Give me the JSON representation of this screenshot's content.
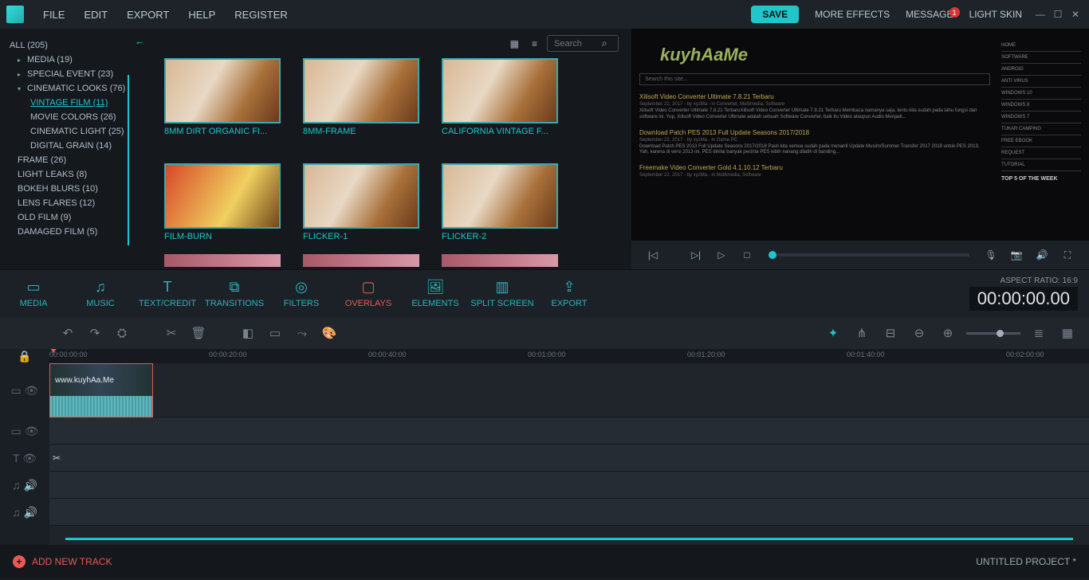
{
  "menu": {
    "file": "FILE",
    "edit": "EDIT",
    "export": "EXPORT",
    "help": "HELP",
    "register": "REGISTER"
  },
  "topbar": {
    "save": "SAVE",
    "more_effects": "MORE EFFECTS",
    "message": "MESSAGE",
    "badge": "1",
    "light_skin": "LIGHT SKIN"
  },
  "sidebar": {
    "items": [
      {
        "label": "ALL (205)",
        "level": 1
      },
      {
        "label": "MEDIA (19)",
        "level": 2,
        "chev": "▸"
      },
      {
        "label": "SPECIAL EVENT (23)",
        "level": 2,
        "chev": "▸"
      },
      {
        "label": "CINEMATIC LOOKS (76)",
        "level": 2,
        "chev": "▾"
      },
      {
        "label": "VINTAGE FILM (11)",
        "level": 3,
        "active": true
      },
      {
        "label": "MOVIE COLORS (26)",
        "level": 3
      },
      {
        "label": "CINEMATIC LIGHT (25)",
        "level": 3
      },
      {
        "label": "DIGITAL GRAIN (14)",
        "level": 3
      },
      {
        "label": "FRAME (26)",
        "level": 2
      },
      {
        "label": "LIGHT LEAKS (8)",
        "level": 2
      },
      {
        "label": "BOKEH BLURS (10)",
        "level": 2
      },
      {
        "label": "LENS FLARES (12)",
        "level": 2
      },
      {
        "label": "OLD FILM (9)",
        "level": 2
      },
      {
        "label": "DAMAGED FILM (5)",
        "level": 2
      }
    ]
  },
  "search": {
    "placeholder": "Search"
  },
  "thumbs": [
    {
      "label": "8MM DIRT ORGANIC FI..."
    },
    {
      "label": "8MM-FRAME"
    },
    {
      "label": "CALIFORNIA VINTAGE F..."
    },
    {
      "label": "FILM-BURN"
    },
    {
      "label": "FLICKER-1"
    },
    {
      "label": "FLICKER-2"
    }
  ],
  "preview": {
    "logo": "kuyhAaMe",
    "search": "Search this site...",
    "entries": [
      {
        "t": "Xilisoft Video Converter Ultimate 7.8.21 Terbaru",
        "m": "September 22, 2017 - by xyzMa - in Converter, Multimedia, Software",
        "d": "Xilisoft Video Converter Ultimate 7.8.21 TerbaruXilisoft Video Converter Ultimate 7.8.21 Terbaru Membaca namanya saja, tentu kita sudah pada tahu fungsi dari software ini. Yup, Xilisoft Video Converter Ultimate adalah sebuah Software Converter, baik itu Video ataupun Audio Menjadi..."
      },
      {
        "t": "Download Patch PES 2013 Full Update Seasons 2017/2018",
        "m": "September 22, 2017 - by xyzMa - in Game PC",
        "d": "Download Patch PES 2013 Full Update Seasons 2017/2018 Pasti kita semua sudah pada menanti Update Musim/Summer Transfer 2017 2018 untuk PES 2013. Yah, karena di versi 2013 ini, PES dinilai banyak pecinta PES lebih nanang dilatih di banding..."
      },
      {
        "t": "Freemake Video Converter Gold 4.1.10.12 Terbaru",
        "m": "September 22, 2017 - by xyzMa - in Multimedia, Software",
        "d": ""
      }
    ],
    "side": [
      "HOME",
      "SOFTWARE",
      "ANDROID",
      "ANTI VIRUS",
      "WINDOWS 10",
      "WINDOWS 8",
      "WINDOWS 7",
      "TUKAR CAMPING",
      "FREE EBOOK",
      "REQUEST",
      "TUTORIAL"
    ],
    "top5": "TOP 5 OF THE WEEK"
  },
  "tabs": [
    {
      "label": "MEDIA",
      "icn": "▭"
    },
    {
      "label": "MUSIC",
      "icn": "♫"
    },
    {
      "label": "TEXT/CREDIT",
      "icn": "T"
    },
    {
      "label": "TRANSITIONS",
      "icn": "⧉"
    },
    {
      "label": "FILTERS",
      "icn": "◎"
    },
    {
      "label": "OVERLAYS",
      "icn": "▢",
      "active": true
    },
    {
      "label": "ELEMENTS",
      "icn": "🖼"
    },
    {
      "label": "SPLIT SCREEN",
      "icn": "▥"
    },
    {
      "label": "EXPORT",
      "icn": "⇪"
    }
  ],
  "tabbar_right": {
    "aspect": "ASPECT RATIO: 16:9",
    "tc": "00:00:00.00"
  },
  "ruler": [
    "00:00:00:00",
    "00:00:20:00",
    "00:00:40:00",
    "00:01:00:00",
    "00:01:20:00",
    "00:01:40:00",
    "00:02:00:00"
  ],
  "clip_text": "www.kuyhAa.Me",
  "footer": {
    "add": "ADD NEW TRACK",
    "project": "UNTITLED PROJECT *"
  }
}
